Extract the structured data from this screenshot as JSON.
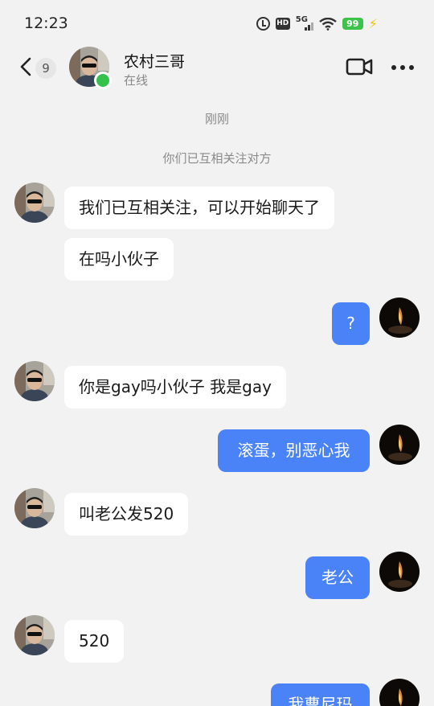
{
  "status_bar": {
    "time": "12:23",
    "hd_label": "HD",
    "network_label": "5G",
    "battery": "99",
    "icons": [
      "alarm-icon",
      "hd-icon",
      "signal-5g-icon",
      "wifi-icon",
      "battery-icon",
      "charging-icon"
    ]
  },
  "header": {
    "unread_count": "9",
    "contact_name": "农村三哥",
    "contact_status": "在线",
    "icons": [
      "back-icon",
      "video-call-icon",
      "more-icon"
    ]
  },
  "conversation": {
    "timestamp": "刚刚",
    "system_notice": "你们已互相关注对方",
    "messages": [
      {
        "side": "in",
        "text": "我们已互相关注，可以开始聊天了"
      },
      {
        "side": "in",
        "text": "在吗小伙子"
      },
      {
        "side": "out",
        "text": "?"
      },
      {
        "side": "in",
        "text": "你是gay吗小伙子 我是gay"
      },
      {
        "side": "out",
        "text": "滚蛋，别恶心我"
      },
      {
        "side": "in",
        "text": "叫老公发520"
      },
      {
        "side": "out",
        "text": "老公"
      },
      {
        "side": "in",
        "text": "520"
      },
      {
        "side": "out",
        "text": "我曹尼玛"
      }
    ]
  },
  "colors": {
    "background": "#f2f2f2",
    "incoming_bubble": "#ffffff",
    "outgoing_bubble": "#4a82f7",
    "online": "#35c24a",
    "battery": "#3dc24a"
  }
}
